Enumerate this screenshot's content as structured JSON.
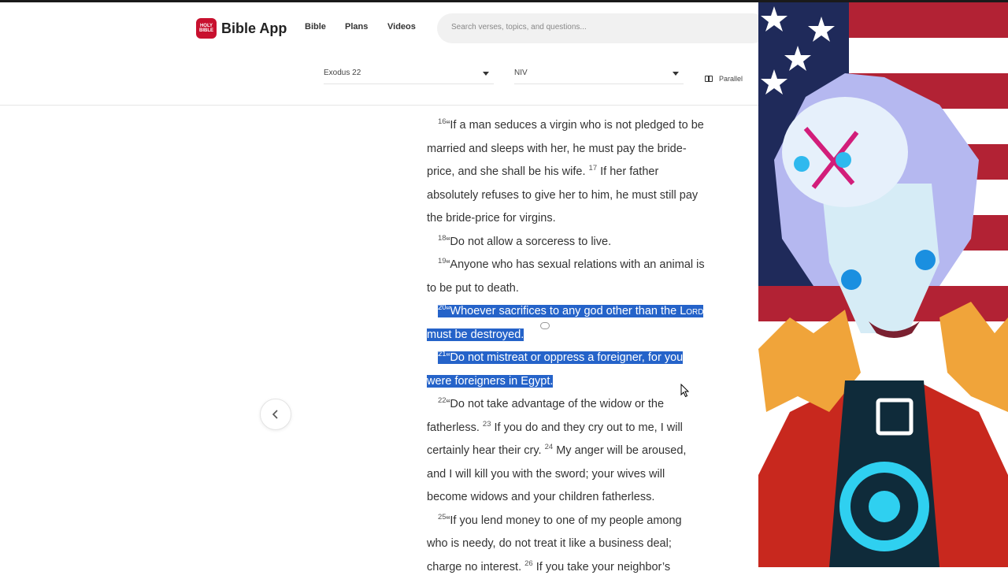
{
  "app": {
    "logo_badge": "HOLY BIBLE",
    "logo_text": "Bible App",
    "nav": [
      "Bible",
      "Plans",
      "Videos"
    ],
    "search_placeholder": "Search verses, topics, and questions..."
  },
  "toolbar": {
    "book_chapter": "Exodus 22",
    "version": "NIV",
    "parallel_label": "Parallel"
  },
  "reader": {
    "lines": [
      {
        "vn": "16",
        "text": "“If a man seduces a virgin who is not pledged to be",
        "indent": true
      },
      {
        "text": "married and sleeps with her, he must pay the bride-"
      },
      {
        "text": "price, and she shall be his wife. ",
        "vn2": "17",
        "text2": " If her father"
      },
      {
        "text": "absolutely refuses to give her to him, he must still pay"
      },
      {
        "text": "the bride-price for virgins."
      },
      {
        "vn": "18",
        "text": "“Do not allow a sorceress to live.",
        "indent": true
      },
      {
        "vn": "19",
        "text": "“Anyone who has sexual relations with an animal is",
        "indent": true
      },
      {
        "text": "to be put to death."
      },
      {
        "vn": "20",
        "text": "“Whoever sacrifices to any god other than the ",
        "sc": "Lord",
        "indent": true,
        "highlight": true
      },
      {
        "text": "must be destroyed.",
        "highlight": true
      },
      {
        "vn": "21",
        "text": "“Do not mistreat or oppress a foreigner, for you",
        "indent": true,
        "highlight": true
      },
      {
        "text": "were foreigners in Egypt.",
        "highlight": true
      },
      {
        "vn": "22",
        "text": "“Do not take advantage of the widow or the",
        "indent": true
      },
      {
        "text": "fatherless. ",
        "vn2": "23",
        "text2": " If you do and they cry out to me, I will"
      },
      {
        "text": "certainly hear their cry. ",
        "vn2": "24",
        "text2": " My anger will be aroused,"
      },
      {
        "text": "and I will kill you with the sword; your wives will"
      },
      {
        "text": "become widows and your children fatherless."
      },
      {
        "vn": "25",
        "text": "“If you lend money to one of my people among",
        "indent": true
      },
      {
        "text": "who is needy, do not treat it like a business deal;"
      },
      {
        "text": "charge no interest. ",
        "vn2": "26",
        "text2": " If you take your neighbor’s"
      }
    ]
  },
  "colors": {
    "highlight": "#2563c9",
    "logo_red": "#c8102e"
  },
  "icons": [
    "chevron-left-icon",
    "parallel-icon",
    "caret-down-icon",
    "note-icon",
    "mouse-cursor-icon"
  ]
}
